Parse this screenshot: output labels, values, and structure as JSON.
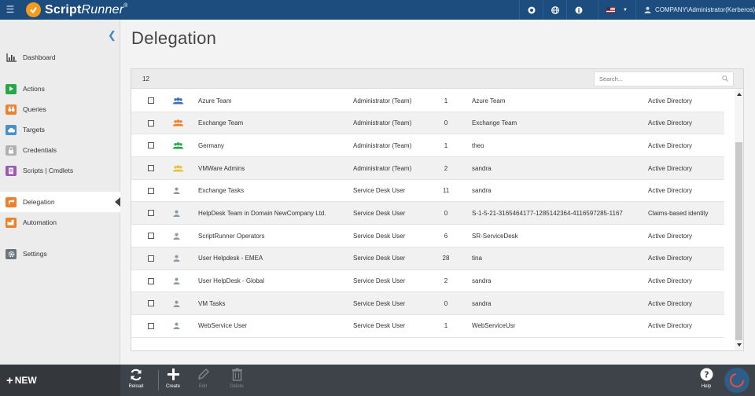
{
  "app": {
    "logo_main": "Script",
    "logo_italic": "Runner",
    "logo_reg": "®",
    "user": "COMPANY\\Administrator(Kerberos)"
  },
  "sidebar": {
    "items": [
      {
        "label": "Dashboard",
        "icon": "dashboard-icon",
        "color": "#ececec"
      },
      {
        "label": "Actions",
        "icon": "play-icon",
        "color": "#28a745"
      },
      {
        "label": "Queries",
        "icon": "binoculars-icon",
        "color": "#f0812b"
      },
      {
        "label": "Targets",
        "icon": "cloud-icon",
        "color": "#4a90c8"
      },
      {
        "label": "Credentials",
        "icon": "lock-icon",
        "color": "#b0b0b0"
      },
      {
        "label": "Scripts | Cmdlets",
        "icon": "script-icon",
        "color": "#9b59b6"
      },
      {
        "label": "Delegation",
        "icon": "share-icon",
        "color": "#f0812b"
      },
      {
        "label": "Automation",
        "icon": "factory-icon",
        "color": "#f0812b"
      },
      {
        "label": "Settings",
        "icon": "gear-icon",
        "color": "#6c757d"
      }
    ]
  },
  "page": {
    "title": "Delegation",
    "count": "12",
    "search_placeholder": "Search..."
  },
  "rows": [
    {
      "name": "Azure Team",
      "role": "Administrator (Team)",
      "num": "1",
      "account": "Azure Team",
      "directory": "Active Directory",
      "icon": "team-icon",
      "icon_color": "#3b6fb6"
    },
    {
      "name": "Exchange Team",
      "role": "Administrator (Team)",
      "num": "0",
      "account": "Exchange Team",
      "directory": "Active Directory",
      "icon": "team-icon",
      "icon_color": "#f0812b"
    },
    {
      "name": "Germany",
      "role": "Administrator (Team)",
      "num": "1",
      "account": "theo",
      "directory": "Active Directory",
      "icon": "team-icon",
      "icon_color": "#28a745"
    },
    {
      "name": "VMWare Admins",
      "role": "Administrator (Team)",
      "num": "2",
      "account": "sandra",
      "directory": "Active Directory",
      "icon": "team-icon",
      "icon_color": "#e8c33a"
    },
    {
      "name": "Exchange Tasks",
      "role": "Service Desk User",
      "num": "11",
      "account": "sandra",
      "directory": "Active Directory",
      "icon": "user-icon",
      "icon_color": "#8a9aa0"
    },
    {
      "name": "HelpDesk Team in Domain NewCompany Ltd.",
      "role": "Service Desk User",
      "num": "0",
      "account": "S-1-5-21-3165464177-1285142364-4116597285-1167",
      "directory": "Claims-based identity",
      "icon": "user-icon",
      "icon_color": "#8a9aa0"
    },
    {
      "name": "ScriptRunner Operators",
      "role": "Service Desk User",
      "num": "6",
      "account": "SR-ServiceDesk",
      "directory": "Active Directory",
      "icon": "user-icon",
      "icon_color": "#8a9aa0"
    },
    {
      "name": "User Helpdesk - EMEA",
      "role": "Service Desk User",
      "num": "28",
      "account": "tina",
      "directory": "Active Directory",
      "icon": "user-icon",
      "icon_color": "#8a9aa0"
    },
    {
      "name": "User HelpDesk - Global",
      "role": "Service Desk User",
      "num": "2",
      "account": "sandra",
      "directory": "Active Directory",
      "icon": "user-icon",
      "icon_color": "#8a9aa0"
    },
    {
      "name": "VM Tasks",
      "role": "Service Desk User",
      "num": "0",
      "account": "sandra",
      "directory": "Active Directory",
      "icon": "user-icon",
      "icon_color": "#8a9aa0"
    },
    {
      "name": "WebService User",
      "role": "Service Desk User",
      "num": "1",
      "account": "WebServiceUsr",
      "directory": "Active Directory",
      "icon": "user-icon",
      "icon_color": "#8a9aa0"
    }
  ],
  "toolbar": {
    "new_label": "NEW",
    "reload": "Reload",
    "create": "Create",
    "edit": "Edit",
    "delete": "Delete",
    "help": "Help"
  }
}
